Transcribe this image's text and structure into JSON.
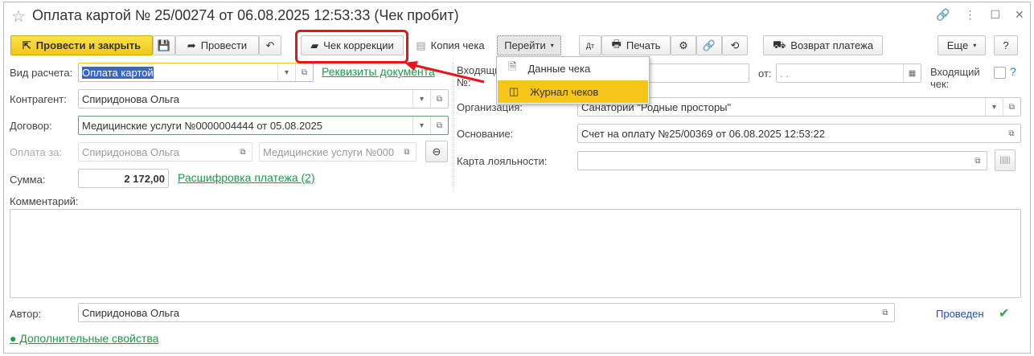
{
  "window": {
    "title": "Оплата картой № 25/00274 от 06.08.2025 12:53:33 (Чек пробит)"
  },
  "toolbar": {
    "post_close": "Провести и закрыть",
    "post": "Провести",
    "correction_check": "Чек коррекции",
    "copy_check": "Копия чека",
    "goto": "Перейти",
    "print": "Печать",
    "refund": "Возврат платежа",
    "more": "Еще",
    "help": "?"
  },
  "goto_menu": {
    "items": [
      {
        "label": "Данные чека"
      },
      {
        "label": "Журнал чеков"
      }
    ]
  },
  "form": {
    "pay_type": {
      "label": "Вид расчета:",
      "value": "Оплата картой"
    },
    "doc_details_link": "Реквизиты документа",
    "counterparty": {
      "label": "Контрагент:",
      "value": "Спиридонова Ольга"
    },
    "contract": {
      "label": "Договор:",
      "value": "Медицинские услуги №0000004444 от 05.08.2025"
    },
    "payment_for": {
      "label": "Оплата за:",
      "value1": "Спиридонова Ольга",
      "value2": "Медицинские услуги №000"
    },
    "sum": {
      "label": "Сумма:",
      "value": "2 172,00"
    },
    "breakdown_link": "Расшифровка платежа (2)",
    "incoming_no": {
      "label": "Входящий №:",
      "value": ""
    },
    "from": {
      "label": "от:",
      "value": " .  ."
    },
    "incoming_check": {
      "label": "Входящий чек:",
      "help": "?"
    },
    "organization": {
      "label": "Организация:",
      "value": "Санаторий \"Родные просторы\""
    },
    "basis": {
      "label": "Основание:",
      "value": "Счет на оплату №25/00369 от 06.08.2025 12:53:22"
    },
    "loyalty": {
      "label": "Карта лояльности:",
      "value": ""
    },
    "comment": {
      "label": "Комментарий:",
      "value": ""
    },
    "author": {
      "label": "Автор:",
      "value": "Спиридонова Ольга"
    },
    "status": "Проведен",
    "extra_link": "● Дополнительные свойства"
  }
}
